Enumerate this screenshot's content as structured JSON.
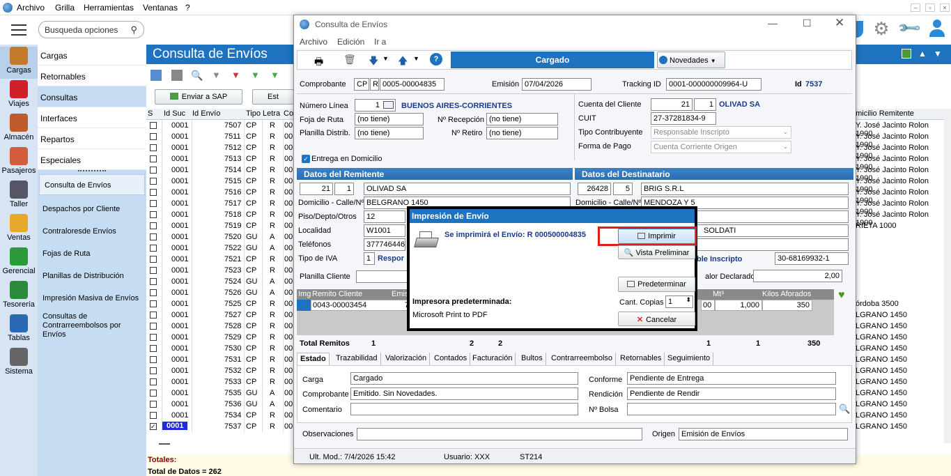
{
  "menu": [
    "Archivo",
    "Grilla",
    "Herramientas",
    "Ventanas",
    "?"
  ],
  "search_placeholder": "Busqueda opciones",
  "rail": [
    {
      "label": "Cargas",
      "icon": "box-icon",
      "color": "#c47a2c"
    },
    {
      "label": "Viajes",
      "icon": "location-pin-icon",
      "color": "#d0202a"
    },
    {
      "label": "Almacén",
      "icon": "warehouse-icon",
      "color": "#c05a2a"
    },
    {
      "label": "Pasajeros",
      "icon": "person-icon",
      "color": "#d35c3c"
    },
    {
      "label": "Taller",
      "icon": "wrench-icon",
      "color": "#556"
    },
    {
      "label": "Ventas",
      "icon": "coins-icon",
      "color": "#e7a92a"
    },
    {
      "label": "Gerencial",
      "icon": "chart-icon",
      "color": "#2a9a3a"
    },
    {
      "label": "Tesorería",
      "icon": "money-icon",
      "color": "#2a8a3a"
    },
    {
      "label": "Tablas",
      "icon": "table-icon",
      "color": "#2a6ab5"
    },
    {
      "label": "Sistema",
      "icon": "gear-icon",
      "color": "#666"
    }
  ],
  "submenu1": [
    "Cargas",
    "Retornables",
    "Consultas",
    "Interfaces",
    "Repartos",
    "Especiales"
  ],
  "submenu2": [
    "Consulta de Envíos",
    "Despachos por Cliente",
    "Contraloresde Envíos",
    "Fojas de Ruta",
    "Planillas de Distribución",
    "Impresión Masiva de Envíos",
    "Consultas de Contrarreembolsos por Envíos"
  ],
  "main_title": "Consulta de Envíos",
  "send_sap": "Enviar a SAP",
  "est_btn": "Est",
  "grid_headers": [
    "S",
    "Id Suc",
    "Id Envío",
    "Tipo",
    "Letra",
    "Co"
  ],
  "grid_right_header": "omicilio Remitente",
  "rows": [
    [
      "0001",
      "7507",
      "CP",
      "R",
      "00",
      "Y. José Jacinto Rolon 1900"
    ],
    [
      "0001",
      "7511",
      "CP",
      "R",
      "00",
      "Y. José Jacinto Rolon 1900"
    ],
    [
      "0001",
      "7512",
      "CP",
      "R",
      "00",
      "Y. José Jacinto Rolon 1900"
    ],
    [
      "0001",
      "7513",
      "CP",
      "R",
      "00",
      "Y. José Jacinto Rolon 1900"
    ],
    [
      "0001",
      "7514",
      "CP",
      "R",
      "00",
      "Y. José Jacinto Rolon 1900"
    ],
    [
      "0001",
      "7515",
      "CP",
      "R",
      "00",
      "Y. José Jacinto Rolon 1900"
    ],
    [
      "0001",
      "7516",
      "CP",
      "R",
      "00",
      "Y. José Jacinto Rolon 1900"
    ],
    [
      "0001",
      "7517",
      "CP",
      "R",
      "00",
      "Y. José Jacinto Rolon 1900"
    ],
    [
      "0001",
      "7518",
      "CP",
      "R",
      "00",
      "Y. José Jacinto Rolon 1900"
    ],
    [
      "0001",
      "7519",
      "CP",
      "R",
      "00",
      "RIETA 1000"
    ],
    [
      "0001",
      "7520",
      "GU",
      "A",
      "00",
      ""
    ],
    [
      "0001",
      "7522",
      "GU",
      "A",
      "00",
      ""
    ],
    [
      "0001",
      "7521",
      "CP",
      "R",
      "00",
      ""
    ],
    [
      "0001",
      "7523",
      "CP",
      "R",
      "00",
      ""
    ],
    [
      "0001",
      "7524",
      "GU",
      "A",
      "00",
      ""
    ],
    [
      "0001",
      "7526",
      "GU",
      "A",
      "00",
      ""
    ],
    [
      "0001",
      "7525",
      "CP",
      "R",
      "00",
      "órdoba 3500"
    ],
    [
      "0001",
      "7527",
      "CP",
      "R",
      "00",
      "LGRANO 1450"
    ],
    [
      "0001",
      "7528",
      "CP",
      "R",
      "00",
      "LGRANO 1450"
    ],
    [
      "0001",
      "7529",
      "CP",
      "R",
      "00",
      "LGRANO 1450"
    ],
    [
      "0001",
      "7530",
      "CP",
      "R",
      "00",
      "LGRANO 1450"
    ],
    [
      "0001",
      "7531",
      "CP",
      "R",
      "00",
      "LGRANO 1450"
    ],
    [
      "0001",
      "7532",
      "CP",
      "R",
      "00",
      "LGRANO 1450"
    ],
    [
      "0001",
      "7533",
      "CP",
      "R",
      "00",
      "LGRANO 1450"
    ],
    [
      "0001",
      "7535",
      "GU",
      "A",
      "00",
      "LGRANO 1450"
    ],
    [
      "0001",
      "7536",
      "GU",
      "A",
      "00",
      "LGRANO 1450"
    ],
    [
      "0001",
      "7534",
      "CP",
      "R",
      "00",
      "LGRANO 1450"
    ],
    [
      "0001",
      "7537",
      "CP",
      "R",
      "00",
      "LGRANO 1450"
    ]
  ],
  "totales": "Totales:",
  "total_datos": "Total de Datos = 262",
  "dialog": {
    "title": "Consulta de Envíos",
    "menu": [
      "Archivo",
      "Edición",
      "Ir a"
    ],
    "status": "Cargado",
    "novedades": "Novedades",
    "comprobante_label": "Comprobante",
    "comp_tipo": "CP",
    "comp_letra": "R",
    "comp_num": "0005-00004835",
    "emision_label": "Emisión",
    "emision": "07/04/2026",
    "tracking_label": "Tracking ID",
    "tracking": "0001-000000009964-U",
    "id_label": "Id",
    "id": "7537",
    "numlinea_label": "Número Línea",
    "numlinea": "1",
    "linea_name": "BUENOS AIRES-CORRIENTES",
    "foja_label": "Foja de Ruta",
    "foja": "(no tiene)",
    "recep_label": "Nº Recepción",
    "recep": "(no tiene)",
    "planilla_label": "Planilla Distrib.",
    "planilla": "(no tiene)",
    "retiro_label": "Nº Retiro",
    "retiro": "(no tiene)",
    "cc_label": "Cuenta del Cliente",
    "cc1": "21",
    "cc2": "1",
    "cc_name": "OLIVAD SA",
    "cuit_label": "CUIT",
    "cuit": "27-37281834-9",
    "tipo_contrib_label": "Tipo Contribuyente",
    "tipo_contrib": "Responsable Inscripto",
    "forma_pago_label": "Forma de Pago",
    "forma_pago": "Cuenta Corriente Origen",
    "entrega_label": "Entrega en Domicilio",
    "remitente_sect": "Datos del Remitente",
    "destinatario_sect": "Datos del Destinatario",
    "rem_c1": "21",
    "rem_c2": "1",
    "rem_name": "OLIVAD SA",
    "dom_label": "Domicilio - Calle/Nº",
    "rem_dom": "BELGRANO 1450",
    "piso_label": "Piso/Depto/Otros",
    "rem_piso": "12",
    "loc_label": "Localidad",
    "rem_loc": "W1001",
    "tel_label": "Teléfonos",
    "rem_tel": "377746446",
    "iva_label": "Tipo de IVA",
    "rem_iva": "1",
    "rem_iva_text": "Respor",
    "dest_c1": "26428",
    "dest_c2": "5",
    "dest_name": "BRIG S.R.L",
    "dest_dom_label": "Domicilio - Calle/Nº",
    "dest_dom": "MENDOZA Y 5",
    "dest_loc": "SOLDATI",
    "dest_iva_text": "ble Inscripto",
    "dest_cuit": "30-68169932-1",
    "valor_label": "alor Declarado",
    "valor": "2,00",
    "planilla_cliente_label": "Planilla Cliente",
    "rem_headers": [
      "Img",
      "Remito Cliente",
      "Emis"
    ],
    "rem_row": "0043-00003454",
    "rem_row2": "7",
    "right_headers": [
      "Mt³",
      "Kilos Aforados"
    ],
    "right_vals": [
      "00",
      "1,000",
      "350"
    ],
    "total_remitos_label": "Total Remitos",
    "total_vals": [
      "1",
      "2",
      "2",
      "1",
      "1",
      "350"
    ],
    "tabs": [
      "Estado",
      "Trazabilidad",
      "Valorización",
      "Contados",
      "Facturación",
      "Bultos",
      "Contrarreembolso",
      "Retornables",
      "Seguimiento"
    ],
    "carga_label": "Carga",
    "carga": "Cargado",
    "conforme_label": "Conforme",
    "conforme": "Pendiente de Entrega",
    "comp2_label": "Comprobante",
    "comp2": "Emitido. Sin Novedades.",
    "rendicion_label": "Rendición",
    "rendicion": "Pendiente de Rendir",
    "coment_label": "Comentario",
    "bolsa_label": "Nº Bolsa",
    "obs_label": "Observaciones",
    "origen_label": "Origen",
    "origen": "Emisión de Envíos",
    "ult_mod": "Ult. Mod.: 7/4/2026 15:42",
    "usuario": "Usuario: XXX",
    "st": "ST214"
  },
  "print": {
    "title": "Impresión de Envío",
    "message": "Se imprimirá el Envío: R 000500004835",
    "imprimir": "Imprimir",
    "vista": "Vista Preliminar",
    "predeterminar": "Predeterminar",
    "impresora_label": "Impresora predeterminada:",
    "impresora": "Microsoft Print to PDF",
    "copias_label": "Cant. Copias",
    "copias": "1",
    "cancelar": "Cancelar"
  }
}
